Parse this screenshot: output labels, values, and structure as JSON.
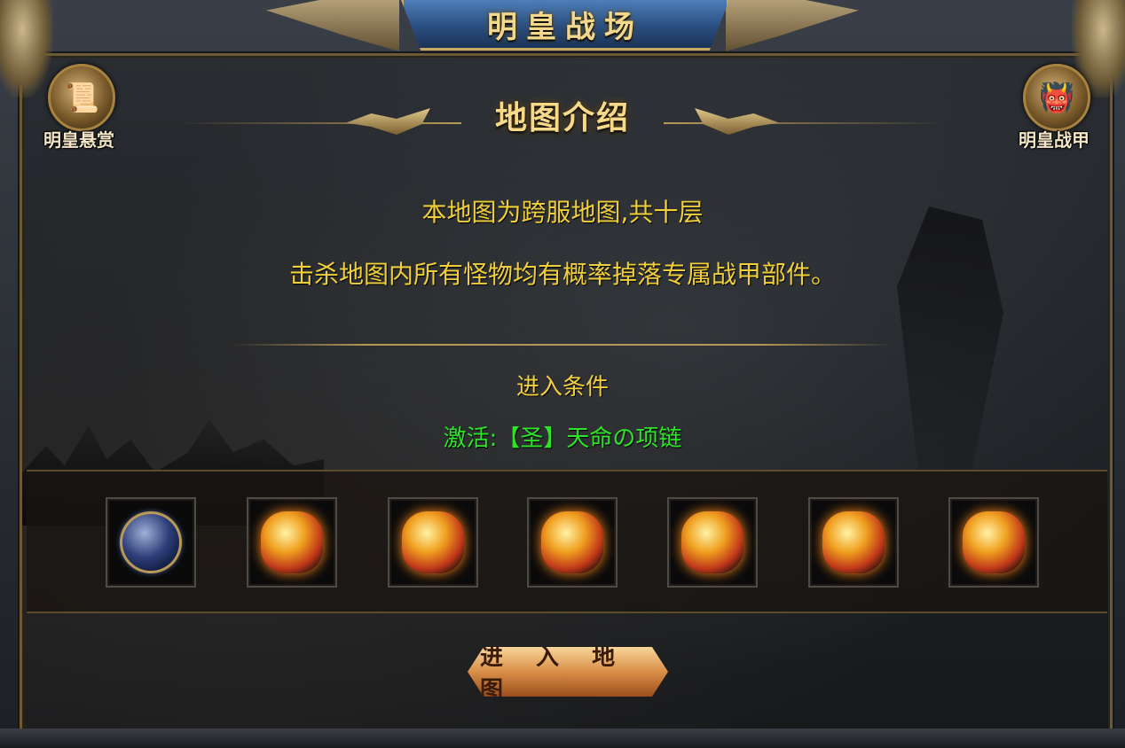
{
  "window": {
    "title": "明皇战场"
  },
  "corner_buttons": {
    "bounty": {
      "label": "明皇悬赏",
      "icon": "scroll-icon"
    },
    "armor": {
      "label": "明皇战甲",
      "icon": "demon-mask-icon"
    }
  },
  "intro": {
    "header": "地图介绍",
    "line1": "本地图为跨服地图,共十层",
    "line2": "击杀地图内所有怪物均有概率掉落专属战甲部件。"
  },
  "condition": {
    "title": "进入条件",
    "value": "激活:【圣】天命の项链"
  },
  "items": [
    {
      "name": "armillary-orb-icon"
    },
    {
      "name": "helmet-icon"
    },
    {
      "name": "necklace-icon"
    },
    {
      "name": "bracer-icon"
    },
    {
      "name": "ring-icon"
    },
    {
      "name": "belt-icon"
    },
    {
      "name": "boots-icon"
    }
  ],
  "enter_button": {
    "label": "进 入 地 图"
  },
  "colors": {
    "gold_text": "#f0cf3a",
    "green_text": "#2ee32a",
    "banner_blue": "#2a4f80",
    "button_orange": "#d98e48"
  }
}
